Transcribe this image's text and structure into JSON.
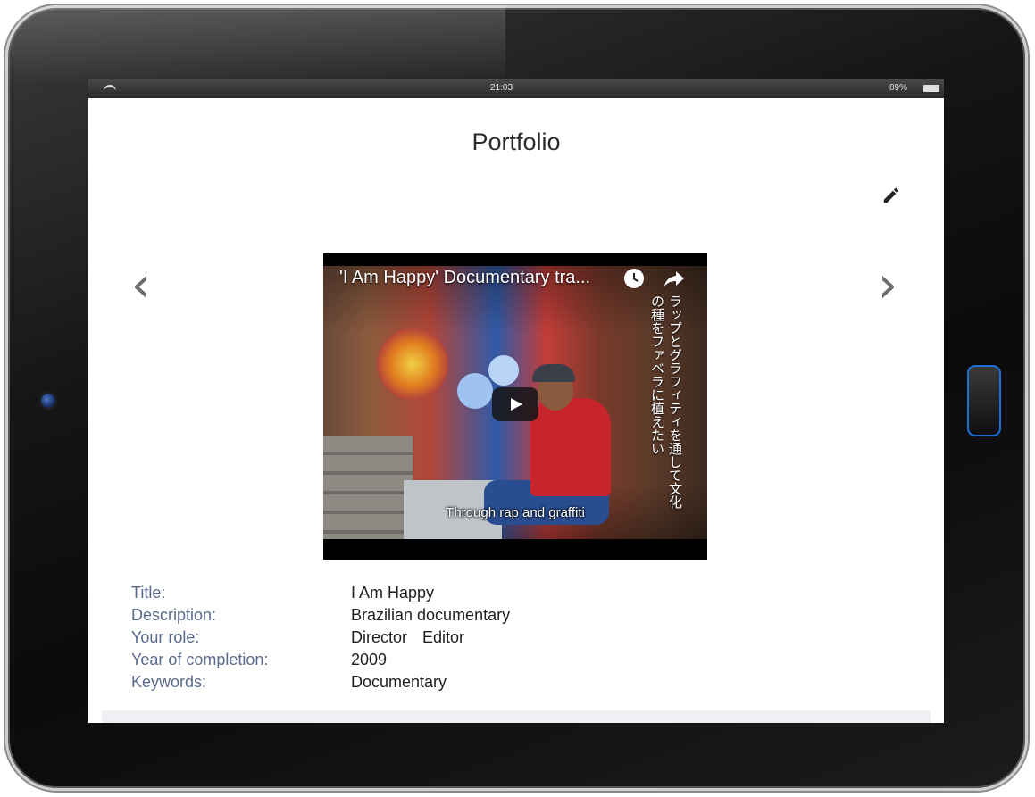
{
  "status_bar": {
    "time": "21:03",
    "battery": "89%"
  },
  "page": {
    "title": "Portfolio"
  },
  "video": {
    "title": "'I Am Happy' Documentary tra...",
    "subtitle": "Through rap and graffiti",
    "vertical_caption": "ラップとグラフィティを通して文化の種をファベラに植えたい"
  },
  "details": {
    "title_label": "Title:",
    "title_value": "I Am Happy",
    "description_label": "Description:",
    "description_value": "Brazilian documentary",
    "role_label": "Your role:",
    "roles": [
      "Director",
      "Editor"
    ],
    "year_label": "Year of completion:",
    "year_value": "2009",
    "keywords_label": "Keywords:",
    "keywords_value": "Documentary"
  },
  "icons": {
    "prev": "chevron-left-icon",
    "next": "chevron-right-icon",
    "edit": "pencil-icon",
    "clock": "watch-later-icon",
    "share": "share-icon",
    "play": "play-icon"
  },
  "colors": {
    "label": "#5b6b8c",
    "value": "#1f1f1f",
    "home_button": "#1b6fd6"
  }
}
